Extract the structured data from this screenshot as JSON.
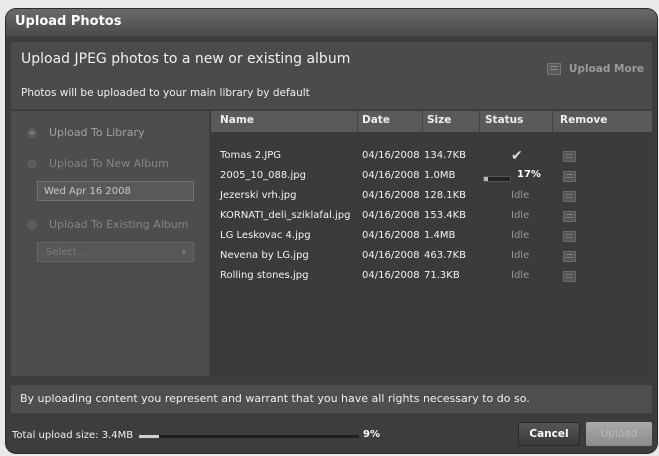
{
  "dialog": {
    "title": "Upload Photos"
  },
  "header": {
    "heading": "Upload JPEG photos to a new or existing album",
    "subheading": "Photos will be uploaded to your main library by default",
    "upload_more_label": "Upload More",
    "upload_more_icon": "upload-more-icon"
  },
  "options": {
    "library": {
      "label": "Upload To Library",
      "selected": true
    },
    "new_album": {
      "label": "Upload To New Album",
      "selected": false
    },
    "new_album_name": "Wed Apr 16 2008",
    "existing_album": {
      "label": "Upload To Existing Album",
      "selected": false
    },
    "album_select": "Select..."
  },
  "table": {
    "columns": [
      "Name",
      "Date",
      "Size",
      "Status",
      "Remove"
    ],
    "rows": [
      {
        "name": "Tomas 2.JPG",
        "date": "04/16/2008",
        "size": "134.7KB",
        "status": "done"
      },
      {
        "name": "2005_10_088.jpg",
        "date": "04/16/2008",
        "size": "1.0MB",
        "status": "17%",
        "progress": 0.17
      },
      {
        "name": "Jezerski vrh.jpg",
        "date": "04/16/2008",
        "size": "128.1KB",
        "status": "Idle"
      },
      {
        "name": "KORNATI_deli_sziklafal.jpg",
        "date": "04/16/2008",
        "size": "153.4KB",
        "status": "Idle"
      },
      {
        "name": "LG Leskovac 4.jpg",
        "date": "04/16/2008",
        "size": "1.4MB",
        "status": "Idle"
      },
      {
        "name": "Nevena by LG.jpg",
        "date": "04/16/2008",
        "size": "463.7KB",
        "status": "Idle"
      },
      {
        "name": "Rolling stones.jpg",
        "date": "04/16/2008",
        "size": "71.3KB",
        "status": "Idle"
      }
    ]
  },
  "terms": "By uploading content you represent and warrant that you have all rights necessary to do so.",
  "footer": {
    "total_label": "Total upload size: 3.4MB",
    "total_progress": 0.09,
    "total_percent": "9%",
    "cancel_label": "Cancel",
    "upload_label": "Upload"
  },
  "colors": {
    "dialog_bg": "#3d3d3d",
    "panel_bg": "#4b4b4b",
    "text": "#f0f0f0",
    "muted": "#858585"
  }
}
